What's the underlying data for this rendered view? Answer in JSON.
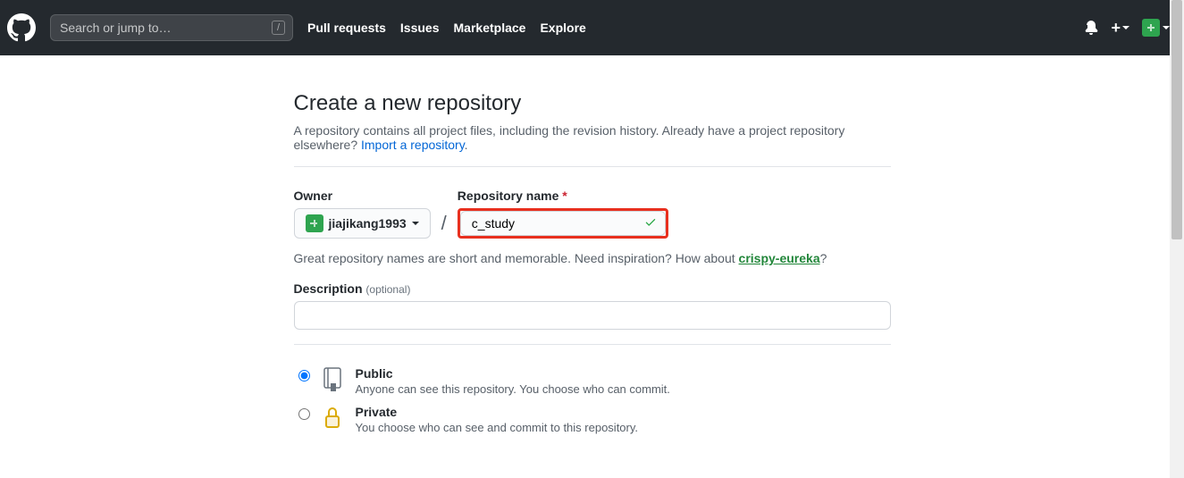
{
  "header": {
    "search_placeholder": "Search or jump to…",
    "slash_key": "/",
    "nav": {
      "pull_requests": "Pull requests",
      "issues": "Issues",
      "marketplace": "Marketplace",
      "explore": "Explore"
    },
    "plus_label": "+"
  },
  "page": {
    "title": "Create a new repository",
    "subtitle_prefix": "A repository contains all project files, including the revision history. Already have a project repository elsewhere? ",
    "import_link": "Import a repository",
    "period": "."
  },
  "form": {
    "owner_label": "Owner",
    "owner_value": "jiajikang1993",
    "slash": "/",
    "repo_label": "Repository name",
    "repo_value": "c_study",
    "hint_prefix": "Great repository names are short and memorable. Need inspiration? How about ",
    "hint_suggestion": "crispy-eureka",
    "hint_suffix": "?",
    "description_label": "Description",
    "description_optional": "(optional)",
    "description_value": "",
    "visibility": {
      "public": {
        "title": "Public",
        "desc": "Anyone can see this repository. You choose who can commit."
      },
      "private": {
        "title": "Private",
        "desc": "You choose who can see and commit to this repository."
      },
      "selected": "public"
    }
  }
}
